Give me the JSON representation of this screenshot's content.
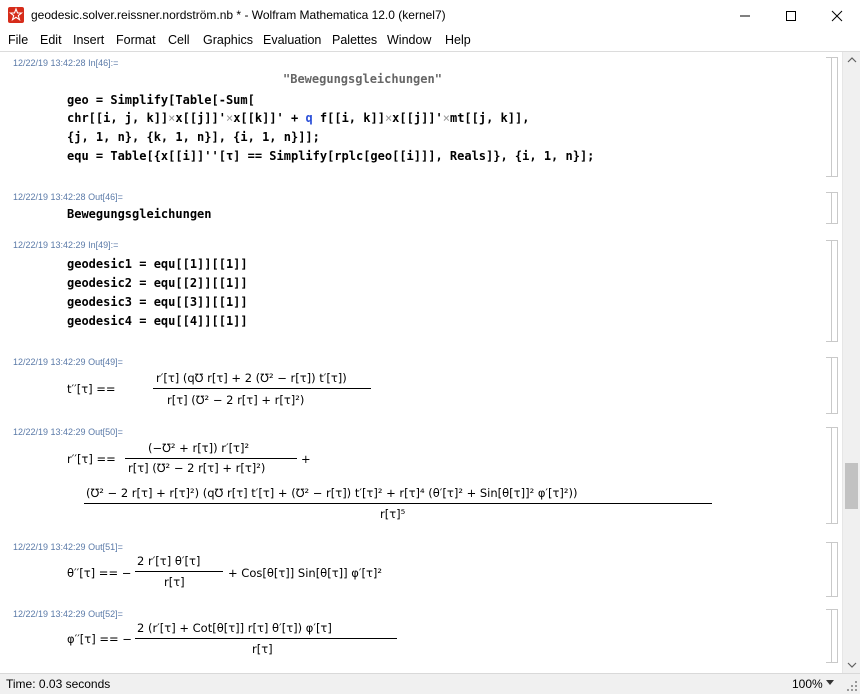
{
  "window": {
    "title": "geodesic.solver.reissner.nordström.nb * - Wolfram Mathematica 12.0 (kernel7)"
  },
  "menu": [
    "File",
    "Edit",
    "Insert",
    "Format",
    "Cell",
    "Graphics",
    "Evaluation",
    "Palettes",
    "Window",
    "Help"
  ],
  "cells": {
    "in46": {
      "label": "12/22/19 13:42:28 In[46]:=",
      "heading": "\"Bewegungsgleichungen\"",
      "line1": "geo = Simplify[Table[-Sum[",
      "line2_a": "chr[[i, j, k]]",
      "line2_b": "x[[j]]'",
      "line2_c": "x[[k]]' + ",
      "line2_q": "q",
      "line2_d": " f[[i, k]]",
      "line2_e": "x[[j]]'",
      "line2_f": "mt[[j, k]],",
      "line3": "{j, 1, n}, {k, 1, n}], {i, 1, n}]];",
      "line4": "equ = Table[{x[[i]]''[τ] == Simplify[rplc[geo[[i]]], Reals]}, {i, 1, n}];"
    },
    "out46": {
      "label": "12/22/19 13:42:28 Out[46]=",
      "text": "Bewegungsgleichungen"
    },
    "in49": {
      "label": "12/22/19 13:42:29 In[49]:=",
      "lines": [
        "geodesic1 = equ[[1]][[1]]",
        "geodesic2 = equ[[2]][[1]]",
        "geodesic3 = equ[[3]][[1]]",
        "geodesic4 = equ[[4]][[1]]"
      ]
    },
    "out49": {
      "label": "12/22/19 13:42:29 Out[49]=",
      "lhs": "t′′[τ] ==",
      "num": "r′[τ] (q℧ r[τ] + 2 (℧² − r[τ]) t′[τ])",
      "den": "r[τ] (℧² − 2 r[τ] + r[τ]²)"
    },
    "out50": {
      "label": "12/22/19 13:42:29 Out[50]=",
      "lhs": "r′′[τ] ==",
      "num1": "(−℧² + r[τ]) r′[τ]²",
      "den1": "r[τ] (℧² − 2 r[τ] + r[τ]²)",
      "plus": "+",
      "num2": "(℧² − 2 r[τ] + r[τ]²) (q℧ r[τ] t′[τ] + (℧² − r[τ]) t′[τ]² + r[τ]⁴ (θ′[τ]² + Sin[θ[τ]]² φ′[τ]²))",
      "den2": "r[τ]⁵"
    },
    "out51": {
      "label": "12/22/19 13:42:29 Out[51]=",
      "lhs": "θ′′[τ] == −",
      "num": "2 r′[τ] θ′[τ]",
      "den": "r[τ]",
      "rest": "+ Cos[θ[τ]] Sin[θ[τ]] φ′[τ]²"
    },
    "out52": {
      "label": "12/22/19 13:42:29 Out[52]=",
      "lhs": "φ′′[τ] == −",
      "num": "2 (r′[τ] + Cot[θ[τ]] r[τ] θ′[τ]) φ′[τ]",
      "den": "r[τ]"
    }
  },
  "status": {
    "time": "Time: 0.03 seconds",
    "zoom": "100%"
  },
  "colors": {
    "cell_label": "#5b7aa8",
    "symbol_blue": "#2a4fd8",
    "app_icon": "#d62c1a"
  }
}
